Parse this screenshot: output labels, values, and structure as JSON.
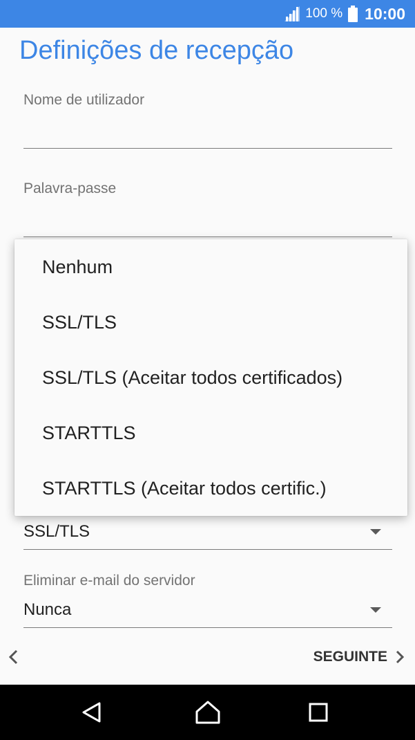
{
  "status_bar": {
    "battery_percent": "100 %",
    "time": "10:00"
  },
  "page": {
    "title": "Definições de recepção"
  },
  "fields": {
    "username_label": "Nome de utilizador",
    "username_value": "",
    "password_label": "Palavra-passe",
    "password_value": "",
    "security_value": "SSL/TLS",
    "delete_email_label": "Eliminar e-mail do servidor",
    "delete_email_value": "Nunca"
  },
  "dropdown": {
    "options": [
      "Nenhum",
      "SSL/TLS",
      "SSL/TLS (Aceitar todos certificados)",
      "STARTTLS",
      "STARTTLS (Aceitar todos certific.)"
    ]
  },
  "footer": {
    "next_label": "SEGUINTE"
  },
  "icons": {
    "signal": "signal-icon",
    "battery": "battery-icon",
    "back": "chevron-left-icon",
    "next": "chevron-right-icon",
    "nav_back": "nav-back-icon",
    "nav_home": "nav-home-icon",
    "nav_recents": "nav-recents-icon"
  },
  "colors": {
    "accent": "#3d86e5",
    "status_bar": "#3d86e5",
    "nav_bar": "#000000"
  }
}
